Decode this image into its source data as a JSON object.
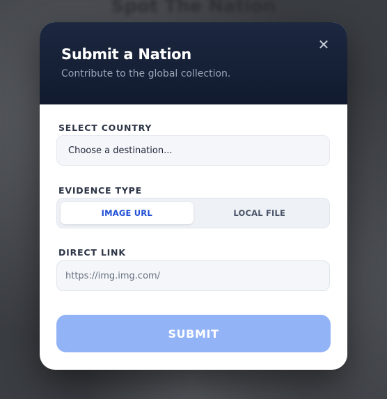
{
  "background": {
    "heading": "Spot The Nation"
  },
  "modal": {
    "title": "Submit a Nation",
    "subtitle": "Contribute to the global collection.",
    "close_icon": "close-icon",
    "country": {
      "label": "SELECT COUNTRY",
      "selected": "Choose a destination..."
    },
    "evidence": {
      "label": "EVIDENCE TYPE",
      "options": [
        "IMAGE URL",
        "LOCAL FILE"
      ],
      "selected": "IMAGE URL"
    },
    "link": {
      "label": "DIRECT LINK",
      "placeholder": "https://img.img.com/",
      "value": ""
    },
    "submit_label": "SUBMIT"
  },
  "colors": {
    "header_bg": "#152036",
    "accent": "#1f4fd6",
    "submit_disabled": "#93b3f7"
  }
}
